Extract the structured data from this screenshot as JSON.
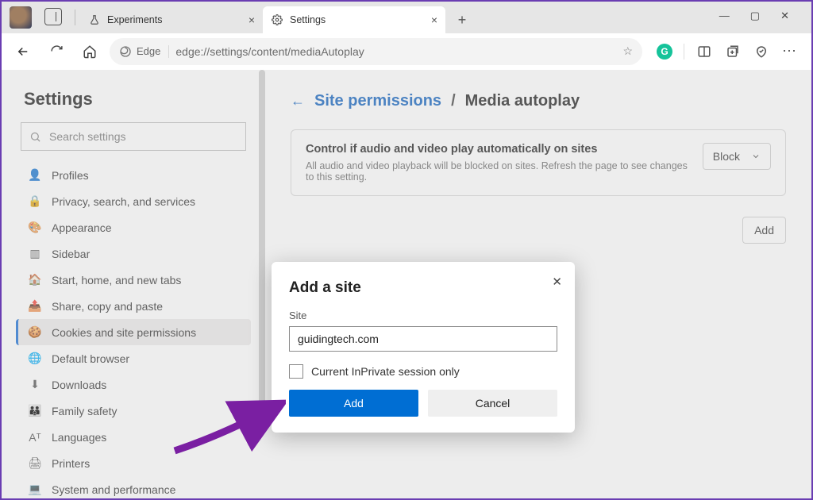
{
  "window": {
    "tab1_label": "Experiments",
    "tab2_label": "Settings",
    "min_glyph": "—",
    "max_glyph": "▢",
    "close_glyph": "✕"
  },
  "toolbar": {
    "edge_label": "Edge",
    "url": "edge://settings/content/mediaAutoplay"
  },
  "sidebar": {
    "title": "Settings",
    "search_placeholder": "Search settings",
    "items": [
      {
        "icon": "👤",
        "label": "Profiles"
      },
      {
        "icon": "🔒",
        "label": "Privacy, search, and services"
      },
      {
        "icon": "🎨",
        "label": "Appearance"
      },
      {
        "icon": "▥",
        "label": "Sidebar"
      },
      {
        "icon": "🏠",
        "label": "Start, home, and new tabs"
      },
      {
        "icon": "📤",
        "label": "Share, copy and paste"
      },
      {
        "icon": "🍪",
        "label": "Cookies and site permissions"
      },
      {
        "icon": "🌐",
        "label": "Default browser"
      },
      {
        "icon": "⬇",
        "label": "Downloads"
      },
      {
        "icon": "👪",
        "label": "Family safety"
      },
      {
        "icon": "Aᵀ",
        "label": "Languages"
      },
      {
        "icon": "🖨",
        "label": "Printers"
      },
      {
        "icon": "💻",
        "label": "System and performance"
      }
    ]
  },
  "main": {
    "back_glyph": "←",
    "crumb_parent": "Site permissions",
    "crumb_sep": "/",
    "crumb_current": "Media autoplay",
    "panel_title": "Control if audio and video play automatically on sites",
    "panel_desc": "All audio and video playback will be blocked on sites. Refresh the page to see changes to this setting.",
    "block_label": "Block",
    "add_label": "Add"
  },
  "dialog": {
    "title": "Add a site",
    "field_label": "Site",
    "field_value": "guidingtech.com",
    "checkbox_label": "Current InPrivate session only",
    "primary": "Add",
    "secondary": "Cancel",
    "close_glyph": "✕"
  },
  "colors": {
    "accent": "#006ed3",
    "link": "#1364c0",
    "annotation": "#7a1fa2"
  }
}
